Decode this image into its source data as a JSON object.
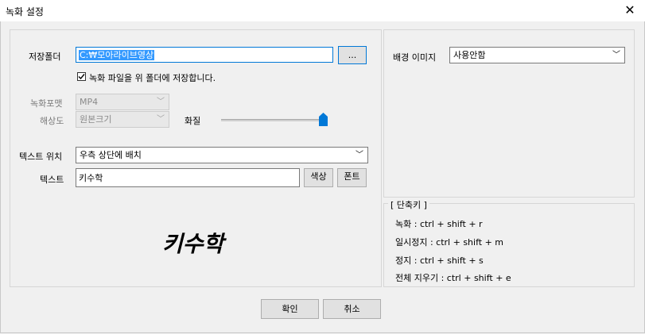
{
  "window": {
    "title": "녹화 설정",
    "close_glyph": "✕"
  },
  "save_folder": {
    "label": "저장폴더",
    "value": "C:₩모아라이브영상",
    "browse_label": "..."
  },
  "save_checkbox": {
    "label": "녹화 파일을 위 폴더에 저장합니다.",
    "checked": true
  },
  "format": {
    "label": "녹화포맷",
    "value": "MP4"
  },
  "resolution": {
    "label": "해상도",
    "value": "원본크기"
  },
  "quality": {
    "label": "화질",
    "slider_level": 1.0
  },
  "text_position": {
    "label": "텍스트 위치",
    "value": "우측 상단에 배치"
  },
  "text": {
    "label": "텍스트",
    "value": "키수학",
    "color_button": "색상",
    "font_button": "폰트"
  },
  "preview": {
    "text": "키수학"
  },
  "background_image": {
    "label": "배경 이미지",
    "value": "사용안함"
  },
  "shortcuts": {
    "title": "[ 단축키 ]",
    "items": [
      "녹화 : ctrl + shift + r",
      "일시정지 : ctrl + shift + m",
      "정지 : ctrl + shift + s",
      "전체 지우기 : ctrl + shift + e"
    ]
  },
  "footer": {
    "ok_label": "확인",
    "cancel_label": "취소"
  },
  "colors": {
    "accent": "#0078d7",
    "selection": "#3399ff",
    "slider_thumb": "#0078d7"
  }
}
